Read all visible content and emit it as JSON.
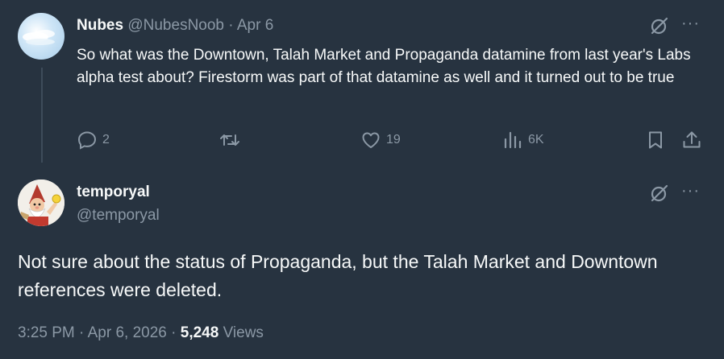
{
  "tweet1": {
    "display_name": "Nubes",
    "handle": "@NubesNoob",
    "separator": "·",
    "date": "Apr 6",
    "text": "So what was the Downtown, Talah Market and Propaganda datamine from last year's Labs alpha test about? Firestorm was part of that datamine as well and it turned out to be true",
    "replies": "2",
    "likes": "19",
    "views": "6K",
    "more": "···"
  },
  "tweet2": {
    "display_name": "temporyal",
    "handle": "@temporyal",
    "text": "Not sure about the status of Propaganda, but the Talah Market and Downtown references were deleted.",
    "time": "3:25 PM",
    "separator": "·",
    "date": "Apr 6, 2026",
    "views_count": "5,248",
    "views_label": "Views",
    "more": "···"
  },
  "colors": {
    "background": "#273340",
    "text_primary": "#f7f9f9",
    "text_secondary": "#8b98a5",
    "thread_line": "#3e4c5a"
  },
  "icons": [
    "reply-icon",
    "retweet-icon",
    "like-icon",
    "views-icon",
    "bookmark-icon",
    "share-icon",
    "grok-icon",
    "more-icon"
  ]
}
